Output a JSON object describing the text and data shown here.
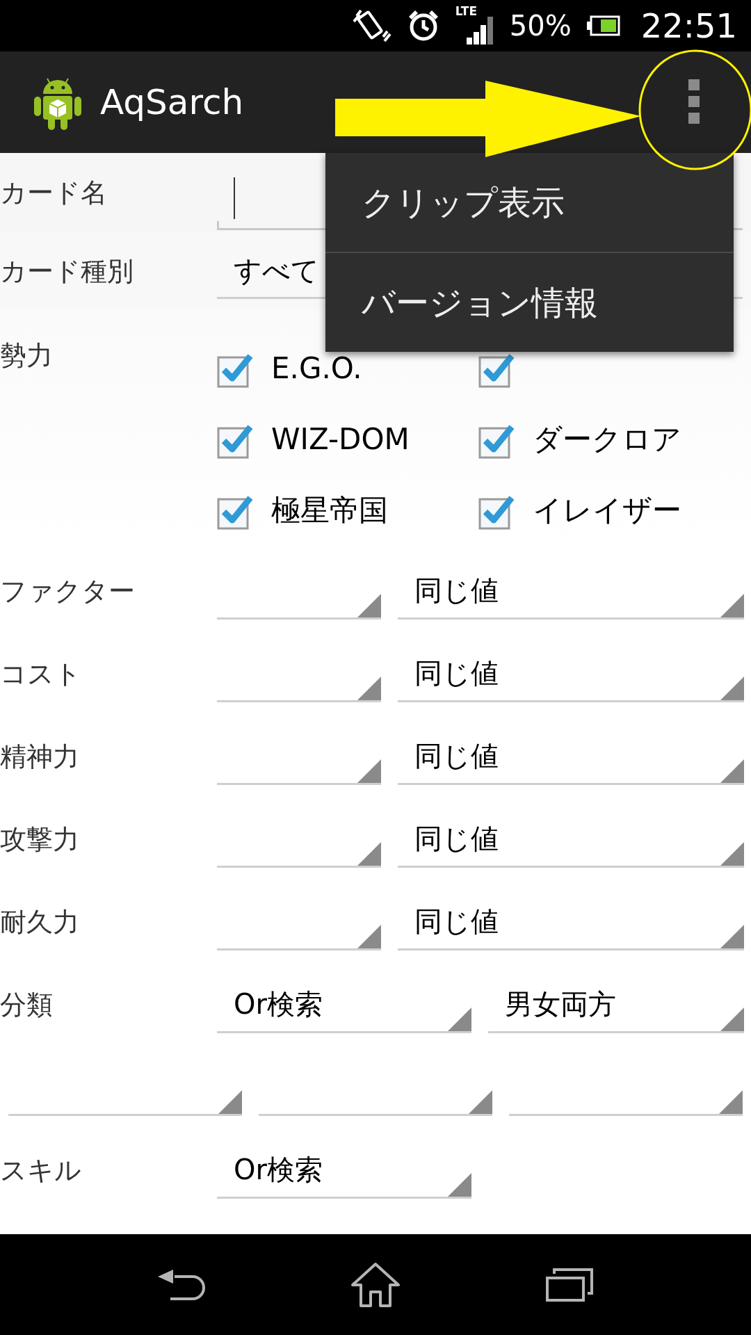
{
  "status_bar": {
    "network": "LTE",
    "battery": "50%",
    "time": "22:51"
  },
  "action_bar": {
    "title": "AqSarch"
  },
  "overflow_menu": {
    "items": [
      "クリップ表示",
      "バージョン情報"
    ]
  },
  "form": {
    "card_name": {
      "label": "カード名"
    },
    "card_type": {
      "label": "カード種別",
      "value": "すべて"
    },
    "faction": {
      "label": "勢力",
      "options": [
        {
          "label": "E.G.O.",
          "checked": true
        },
        {
          "checked": true
        },
        {
          "label": "WIZ-DOM",
          "checked": true
        },
        {
          "label": "ダークロア",
          "checked": true
        },
        {
          "label": "極星帝国",
          "checked": true
        },
        {
          "label": "イレイザー",
          "checked": true
        }
      ]
    },
    "ranges": [
      {
        "label": "ファクター",
        "mode": "同じ値"
      },
      {
        "label": "コスト",
        "mode": "同じ値"
      },
      {
        "label": "精神力",
        "mode": "同じ値"
      },
      {
        "label": "攻撃力",
        "mode": "同じ値"
      },
      {
        "label": "耐久力",
        "mode": "同じ値"
      }
    ],
    "classification": {
      "label": "分類",
      "mode": "Or検索",
      "gender": "男女両方"
    },
    "skill": {
      "label": "スキル",
      "mode": "Or検索"
    }
  }
}
